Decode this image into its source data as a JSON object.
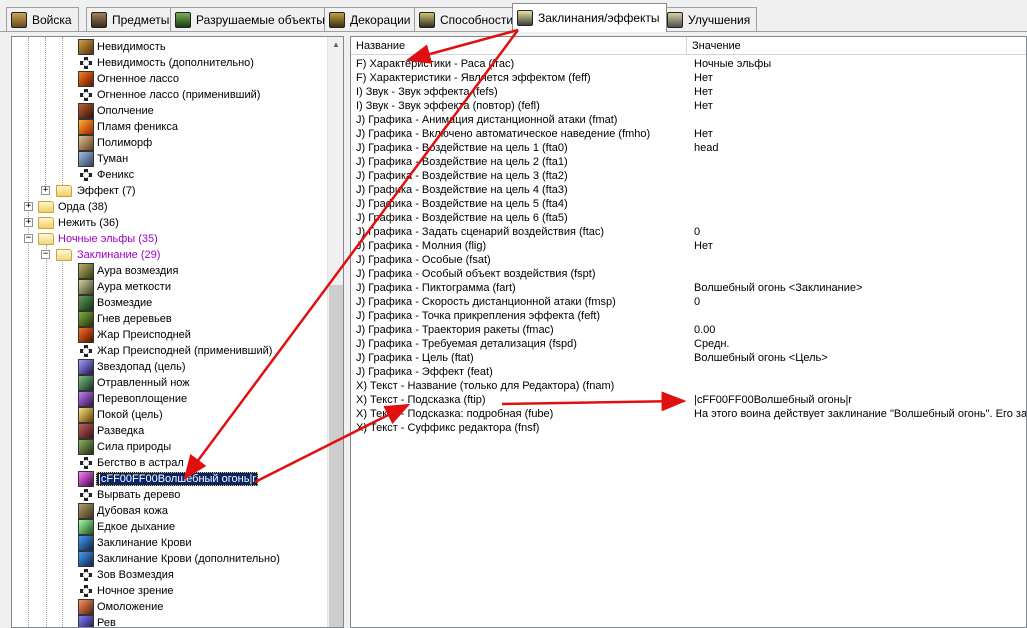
{
  "tabs": [
    {
      "label": "Войска",
      "icon": "helmet-icon"
    },
    {
      "label": "Предметы",
      "icon": "chest-icon"
    },
    {
      "label": "Разрушаемые объекты",
      "icon": "tree-icon"
    },
    {
      "label": "Декорации",
      "icon": "statue-icon"
    },
    {
      "label": "Способности",
      "icon": "ability-icon"
    },
    {
      "label": "Заклинания/эффекты",
      "icon": "spell-icon"
    },
    {
      "label": "Улучшения",
      "icon": "shield-icon"
    }
  ],
  "active_tab": "Заклинания/эффекты",
  "tree": {
    "items_top": [
      {
        "label": "Невидимость",
        "icon": "invisibility-icon"
      },
      {
        "label": "Невидимость (дополнительно)",
        "icon": "helper-icon"
      },
      {
        "label": "Огненное лассо",
        "icon": "fire-lasso-icon"
      },
      {
        "label": "Огненное лассо (применивший)",
        "icon": "helper-icon"
      },
      {
        "label": "Ополчение",
        "icon": "militia-icon"
      },
      {
        "label": "Пламя феникса",
        "icon": "phoenix-fire-icon"
      },
      {
        "label": "Полиморф",
        "icon": "polymorph-icon"
      },
      {
        "label": "Туман",
        "icon": "cloud-icon"
      },
      {
        "label": "Феникс",
        "icon": "helper-icon"
      }
    ],
    "folder_effect": "Эффект (7)",
    "folder_orda": "Орда (38)",
    "folder_undead": "Нежить (36)",
    "folder_nightelf": "Ночные эльфы (35)",
    "folder_spells": "Заклинание (29)",
    "items_spells": [
      {
        "label": "Аура возмездия",
        "icon": "thorns-aura-icon"
      },
      {
        "label": "Аура меткости",
        "icon": "trueshot-aura-icon"
      },
      {
        "label": "Возмездие",
        "icon": "vengeance-icon"
      },
      {
        "label": "Гнев деревьев",
        "icon": "wrath-icon"
      },
      {
        "label": "Жар Преисподней",
        "icon": "immolation-icon"
      },
      {
        "label": "Жар Преисподней (применивший)",
        "icon": "helper-icon"
      },
      {
        "label": "Звездопад (цель)",
        "icon": "starfall-icon"
      },
      {
        "label": "Отравленный нож",
        "icon": "poison-icon"
      },
      {
        "label": "Перевоплощение",
        "icon": "metamorphosis-icon"
      },
      {
        "label": "Покой (цель)",
        "icon": "tranquility-icon"
      },
      {
        "label": "Разведка",
        "icon": "scout-icon"
      },
      {
        "label": "Сила природы",
        "icon": "force-of-nature-icon"
      },
      {
        "label": "Бегство в астрал",
        "icon": "helper-icon"
      },
      {
        "label": "|cFF00FF00Волшебный огонь|r",
        "icon": "faerie-fire-icon",
        "selected": true
      },
      {
        "label": "Вырвать дерево",
        "icon": "helper-icon"
      },
      {
        "label": "Дубовая кожа",
        "icon": "barkskin-icon"
      },
      {
        "label": "Едкое дыхание",
        "icon": "corrosive-breath-icon"
      },
      {
        "label": "Заклинание Крови",
        "icon": "blood-icon"
      },
      {
        "label": "Заклинание Крови (дополнительно)",
        "icon": "blood-icon"
      },
      {
        "label": "Зов Возмездия",
        "icon": "helper-icon"
      },
      {
        "label": "Ночное зрение",
        "icon": "helper-icon"
      },
      {
        "label": "Омоложение",
        "icon": "rejuvenation-icon"
      },
      {
        "label": "Рев",
        "icon": "roar-icon"
      }
    ]
  },
  "grid": {
    "col_name": "Название",
    "col_value": "Значение",
    "rows": [
      {
        "name": "F) Характеристики - Раса (frac)",
        "value": "Ночные эльфы"
      },
      {
        "name": "F) Характеристики - Является эффектом (feff)",
        "value": "Нет"
      },
      {
        "name": "I) Звук - Звук эффекта (fefs)",
        "value": "Нет"
      },
      {
        "name": "I) Звук - Звук эффекта (повтор) (fefl)",
        "value": "Нет"
      },
      {
        "name": "J) Графика - Анимация дистанционной атаки (fmat)",
        "value": ""
      },
      {
        "name": "J) Графика - Включено автоматическое наведение (fmho)",
        "value": "Нет"
      },
      {
        "name": "J) Графика - Воздействие на цель 1 (fta0)",
        "value": "head"
      },
      {
        "name": "J) Графика - Воздействие на цель 2 (fta1)",
        "value": ""
      },
      {
        "name": "J) Графика - Воздействие на цель 3 (fta2)",
        "value": ""
      },
      {
        "name": "J) Графика - Воздействие на цель 4 (fta3)",
        "value": ""
      },
      {
        "name": "J) Графика - Воздействие на цель 5 (fta4)",
        "value": ""
      },
      {
        "name": "J) Графика - Воздействие на цель 6 (fta5)",
        "value": ""
      },
      {
        "name": "J) Графика - Задать сценарий воздействия (ftac)",
        "value": "0"
      },
      {
        "name": "J) Графика - Молния (flig)",
        "value": "Нет"
      },
      {
        "name": "J) Графика - Особые (fsat)",
        "value": ""
      },
      {
        "name": "J) Графика - Особый объект воздействия (fspt)",
        "value": ""
      },
      {
        "name": "J) Графика - Пиктограмма (fart)",
        "value": "Волшебный огонь <Заклинание>"
      },
      {
        "name": "J) Графика - Скорость дистанционной атаки (fmsp)",
        "value": "0"
      },
      {
        "name": "J) Графика - Точка прикрепления эффекта (feft)",
        "value": ""
      },
      {
        "name": "J) Графика - Траектория ракеты (fmac)",
        "value": "0.00"
      },
      {
        "name": "J) Графика - Требуемая детализация (fspd)",
        "value": "Средн."
      },
      {
        "name": "J) Графика - Цель (ftat)",
        "value": "Волшебный огонь <Цель>"
      },
      {
        "name": "J) Графика - Эффект (feat)",
        "value": ""
      },
      {
        "name": "X) Текст - Название (только для Редактора) (fnam)",
        "value": ""
      },
      {
        "name": "X) Текст - Подсказка (ftip)",
        "value": "|cFF00FF00Волшебный огонь|r"
      },
      {
        "name": "X) Текст - Подсказка: подробная (fube)",
        "value": "На этого воина действует заклинание \"Волшебный огонь\". Его за"
      },
      {
        "name": "X) Текст - Суффикс редактора (fnsf)",
        "value": ""
      }
    ]
  },
  "colors": {
    "annotation_arrow": "#e01010",
    "selection_bg": "#0a246a",
    "purple_folder": "#a000c8"
  }
}
